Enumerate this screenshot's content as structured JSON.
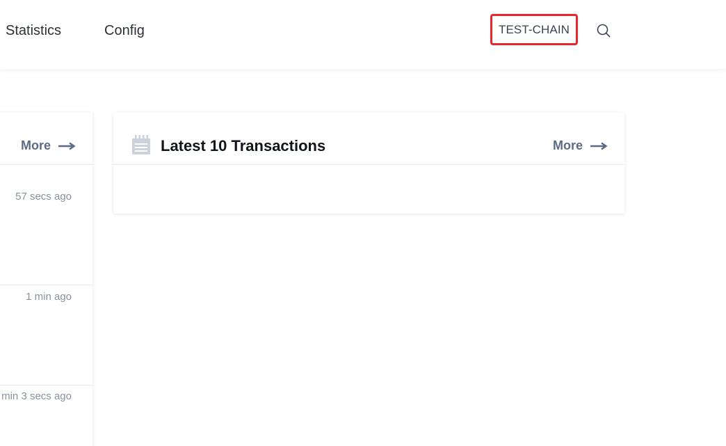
{
  "header": {
    "nav": [
      {
        "label": "Statistics"
      },
      {
        "label": "Config"
      }
    ],
    "chain_label": "TEST-CHAIN",
    "search_icon": "search-icon",
    "highlight_color": "#e8262b"
  },
  "blocks_panel": {
    "more_label": "More",
    "rows": [
      {
        "time": "57 secs ago"
      },
      {
        "time": "1 min ago"
      },
      {
        "time": "min 3 secs ago"
      }
    ]
  },
  "transactions_panel": {
    "title": "Latest 10 Transactions",
    "icon": "calendar-icon",
    "more_label": "More"
  },
  "colors": {
    "more_link": "#5b6b86",
    "time_text": "#8a919c"
  }
}
